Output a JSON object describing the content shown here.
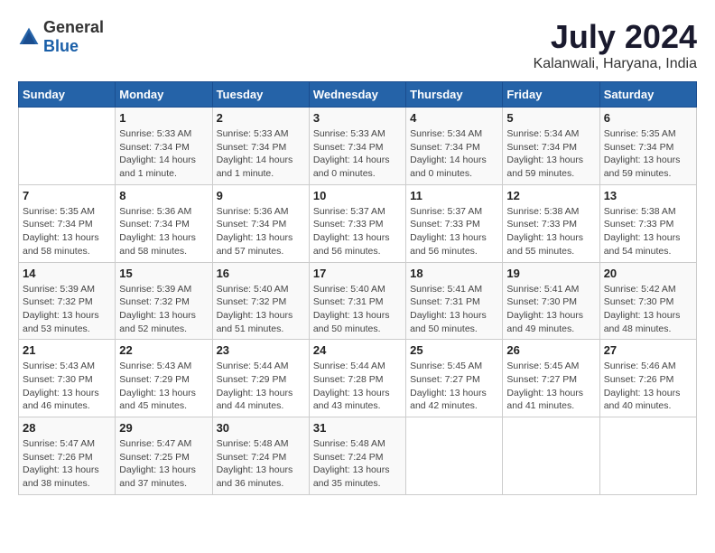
{
  "logo": {
    "general": "General",
    "blue": "Blue"
  },
  "header": {
    "title": "July 2024",
    "subtitle": "Kalanwali, Haryana, India"
  },
  "days_of_week": [
    "Sunday",
    "Monday",
    "Tuesday",
    "Wednesday",
    "Thursday",
    "Friday",
    "Saturday"
  ],
  "weeks": [
    [
      {
        "day": "",
        "info": ""
      },
      {
        "day": "1",
        "info": "Sunrise: 5:33 AM\nSunset: 7:34 PM\nDaylight: 14 hours\nand 1 minute."
      },
      {
        "day": "2",
        "info": "Sunrise: 5:33 AM\nSunset: 7:34 PM\nDaylight: 14 hours\nand 1 minute."
      },
      {
        "day": "3",
        "info": "Sunrise: 5:33 AM\nSunset: 7:34 PM\nDaylight: 14 hours\nand 0 minutes."
      },
      {
        "day": "4",
        "info": "Sunrise: 5:34 AM\nSunset: 7:34 PM\nDaylight: 14 hours\nand 0 minutes."
      },
      {
        "day": "5",
        "info": "Sunrise: 5:34 AM\nSunset: 7:34 PM\nDaylight: 13 hours\nand 59 minutes."
      },
      {
        "day": "6",
        "info": "Sunrise: 5:35 AM\nSunset: 7:34 PM\nDaylight: 13 hours\nand 59 minutes."
      }
    ],
    [
      {
        "day": "7",
        "info": "Sunrise: 5:35 AM\nSunset: 7:34 PM\nDaylight: 13 hours\nand 58 minutes."
      },
      {
        "day": "8",
        "info": "Sunrise: 5:36 AM\nSunset: 7:34 PM\nDaylight: 13 hours\nand 58 minutes."
      },
      {
        "day": "9",
        "info": "Sunrise: 5:36 AM\nSunset: 7:34 PM\nDaylight: 13 hours\nand 57 minutes."
      },
      {
        "day": "10",
        "info": "Sunrise: 5:37 AM\nSunset: 7:33 PM\nDaylight: 13 hours\nand 56 minutes."
      },
      {
        "day": "11",
        "info": "Sunrise: 5:37 AM\nSunset: 7:33 PM\nDaylight: 13 hours\nand 56 minutes."
      },
      {
        "day": "12",
        "info": "Sunrise: 5:38 AM\nSunset: 7:33 PM\nDaylight: 13 hours\nand 55 minutes."
      },
      {
        "day": "13",
        "info": "Sunrise: 5:38 AM\nSunset: 7:33 PM\nDaylight: 13 hours\nand 54 minutes."
      }
    ],
    [
      {
        "day": "14",
        "info": "Sunrise: 5:39 AM\nSunset: 7:32 PM\nDaylight: 13 hours\nand 53 minutes."
      },
      {
        "day": "15",
        "info": "Sunrise: 5:39 AM\nSunset: 7:32 PM\nDaylight: 13 hours\nand 52 minutes."
      },
      {
        "day": "16",
        "info": "Sunrise: 5:40 AM\nSunset: 7:32 PM\nDaylight: 13 hours\nand 51 minutes."
      },
      {
        "day": "17",
        "info": "Sunrise: 5:40 AM\nSunset: 7:31 PM\nDaylight: 13 hours\nand 50 minutes."
      },
      {
        "day": "18",
        "info": "Sunrise: 5:41 AM\nSunset: 7:31 PM\nDaylight: 13 hours\nand 50 minutes."
      },
      {
        "day": "19",
        "info": "Sunrise: 5:41 AM\nSunset: 7:30 PM\nDaylight: 13 hours\nand 49 minutes."
      },
      {
        "day": "20",
        "info": "Sunrise: 5:42 AM\nSunset: 7:30 PM\nDaylight: 13 hours\nand 48 minutes."
      }
    ],
    [
      {
        "day": "21",
        "info": "Sunrise: 5:43 AM\nSunset: 7:30 PM\nDaylight: 13 hours\nand 46 minutes."
      },
      {
        "day": "22",
        "info": "Sunrise: 5:43 AM\nSunset: 7:29 PM\nDaylight: 13 hours\nand 45 minutes."
      },
      {
        "day": "23",
        "info": "Sunrise: 5:44 AM\nSunset: 7:29 PM\nDaylight: 13 hours\nand 44 minutes."
      },
      {
        "day": "24",
        "info": "Sunrise: 5:44 AM\nSunset: 7:28 PM\nDaylight: 13 hours\nand 43 minutes."
      },
      {
        "day": "25",
        "info": "Sunrise: 5:45 AM\nSunset: 7:27 PM\nDaylight: 13 hours\nand 42 minutes."
      },
      {
        "day": "26",
        "info": "Sunrise: 5:45 AM\nSunset: 7:27 PM\nDaylight: 13 hours\nand 41 minutes."
      },
      {
        "day": "27",
        "info": "Sunrise: 5:46 AM\nSunset: 7:26 PM\nDaylight: 13 hours\nand 40 minutes."
      }
    ],
    [
      {
        "day": "28",
        "info": "Sunrise: 5:47 AM\nSunset: 7:26 PM\nDaylight: 13 hours\nand 38 minutes."
      },
      {
        "day": "29",
        "info": "Sunrise: 5:47 AM\nSunset: 7:25 PM\nDaylight: 13 hours\nand 37 minutes."
      },
      {
        "day": "30",
        "info": "Sunrise: 5:48 AM\nSunset: 7:24 PM\nDaylight: 13 hours\nand 36 minutes."
      },
      {
        "day": "31",
        "info": "Sunrise: 5:48 AM\nSunset: 7:24 PM\nDaylight: 13 hours\nand 35 minutes."
      },
      {
        "day": "",
        "info": ""
      },
      {
        "day": "",
        "info": ""
      },
      {
        "day": "",
        "info": ""
      }
    ]
  ]
}
